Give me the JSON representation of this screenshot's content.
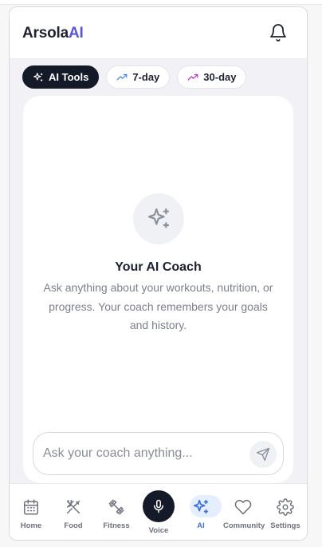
{
  "header": {
    "logo_main": "Arsola",
    "logo_accent": "AI",
    "bell_icon": "bell-icon"
  },
  "tabs": [
    {
      "label": "AI Tools",
      "icon": "sparkles-icon",
      "active": true
    },
    {
      "label": "7-day",
      "icon": "trending-up-icon",
      "active": false
    },
    {
      "label": "30-day",
      "icon": "trending-up-icon",
      "active": false
    }
  ],
  "coach": {
    "icon": "sparkles-icon",
    "title": "Your AI Coach",
    "description": "Ask anything about your workouts, nutrition, or progress. Your coach remembers your goals and history."
  },
  "chat_input": {
    "placeholder": "Ask your coach anything...",
    "value": "",
    "send_icon": "send-icon"
  },
  "nav": {
    "items": [
      {
        "label": "Home",
        "icon": "calendar-icon"
      },
      {
        "label": "Food",
        "icon": "utensils-icon"
      },
      {
        "label": "Fitness",
        "icon": "dumbbell-icon"
      },
      {
        "label": "Voice",
        "icon": "microphone-icon"
      },
      {
        "label": "AI",
        "icon": "sparkles-icon",
        "active": true
      },
      {
        "label": "Community",
        "icon": "heart-icon"
      },
      {
        "label": "Settings",
        "icon": "gear-icon"
      }
    ]
  },
  "colors": {
    "accent": "#5a55e6",
    "dark": "#151a28",
    "active_blue": "#3b6fe6",
    "trend_7day": "#3b82f6",
    "trend_30day": "#c026d3"
  }
}
